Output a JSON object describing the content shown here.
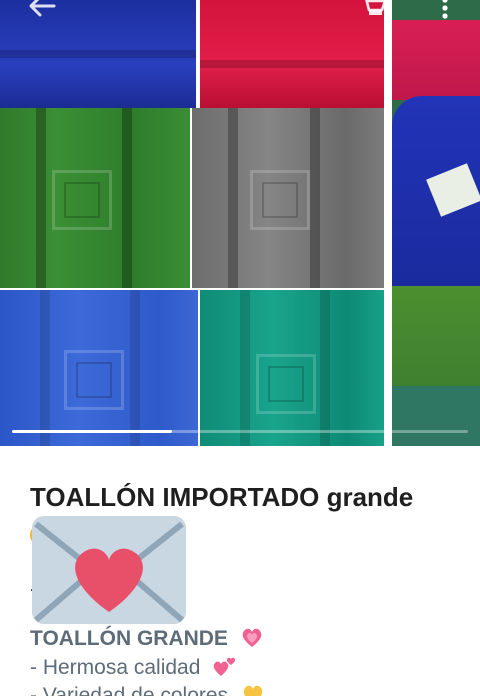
{
  "toolbar": {
    "back_icon": "arrow-left-icon",
    "cart_icon": "shopping-cart-icon",
    "more_icon": "more-vertical-icon"
  },
  "carousel": {
    "slide_count_hint": "multiple",
    "current_progress": 0.35,
    "main_image": "stacked colored towels (navy, red, green, grey, blue, teal)",
    "next_image": "towels with label on grass"
  },
  "product": {
    "title": "TOALLÓN IMPORTADO grande",
    "sub_heading": "TOALLÓN GRANDE",
    "features": [
      "- Hermosa calidad",
      "- Variedad de colores"
    ]
  },
  "emojis": {
    "envelope": "love-letter-icon",
    "sub_heading": "growing-heart-icon",
    "feature_1": "two-hearts-icon",
    "feature_2": "yellow-heart-icon"
  },
  "colors": {
    "title": "#1f1f1f",
    "body_text": "#5e6b78",
    "heart_pink": "#f06292",
    "heart_yellow": "#f6c343"
  }
}
